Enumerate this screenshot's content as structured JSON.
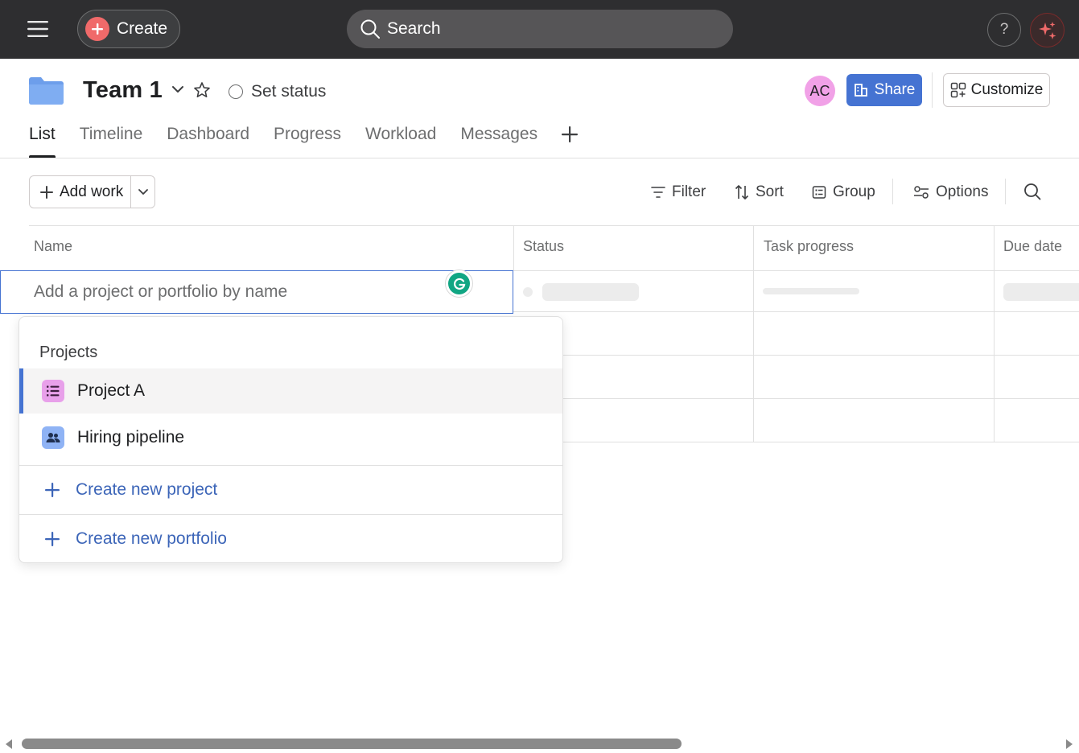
{
  "topbar": {
    "create_label": "Create",
    "search_label": "Search",
    "help_label": "?"
  },
  "project": {
    "title": "Team 1",
    "set_status_label": "Set status",
    "avatar_initials": "AC",
    "share_label": "Share",
    "customize_label": "Customize"
  },
  "tabs": [
    {
      "label": "List",
      "active": true
    },
    {
      "label": "Timeline"
    },
    {
      "label": "Dashboard"
    },
    {
      "label": "Progress"
    },
    {
      "label": "Workload"
    },
    {
      "label": "Messages"
    }
  ],
  "toolbar": {
    "add_work_label": "Add work",
    "filter_label": "Filter",
    "sort_label": "Sort",
    "group_label": "Group",
    "options_label": "Options"
  },
  "table": {
    "columns": [
      "Name",
      "Status",
      "Task progress",
      "Due date"
    ],
    "name_input_placeholder": "Add a project or portfolio by name"
  },
  "dropdown": {
    "header": "Projects",
    "items": [
      {
        "label": "Project A",
        "icon": "list-icon",
        "color": "#e8a0ea"
      },
      {
        "label": "Hiring pipeline",
        "icon": "people-icon",
        "color": "#8fb3f5"
      }
    ],
    "create_project_label": "Create new project",
    "create_portfolio_label": "Create new portfolio"
  },
  "colors": {
    "topbar_bg": "#2e2e30",
    "accent_blue": "#4573d2",
    "create_red": "#f06a6a",
    "link_blue": "#3c65b8"
  }
}
